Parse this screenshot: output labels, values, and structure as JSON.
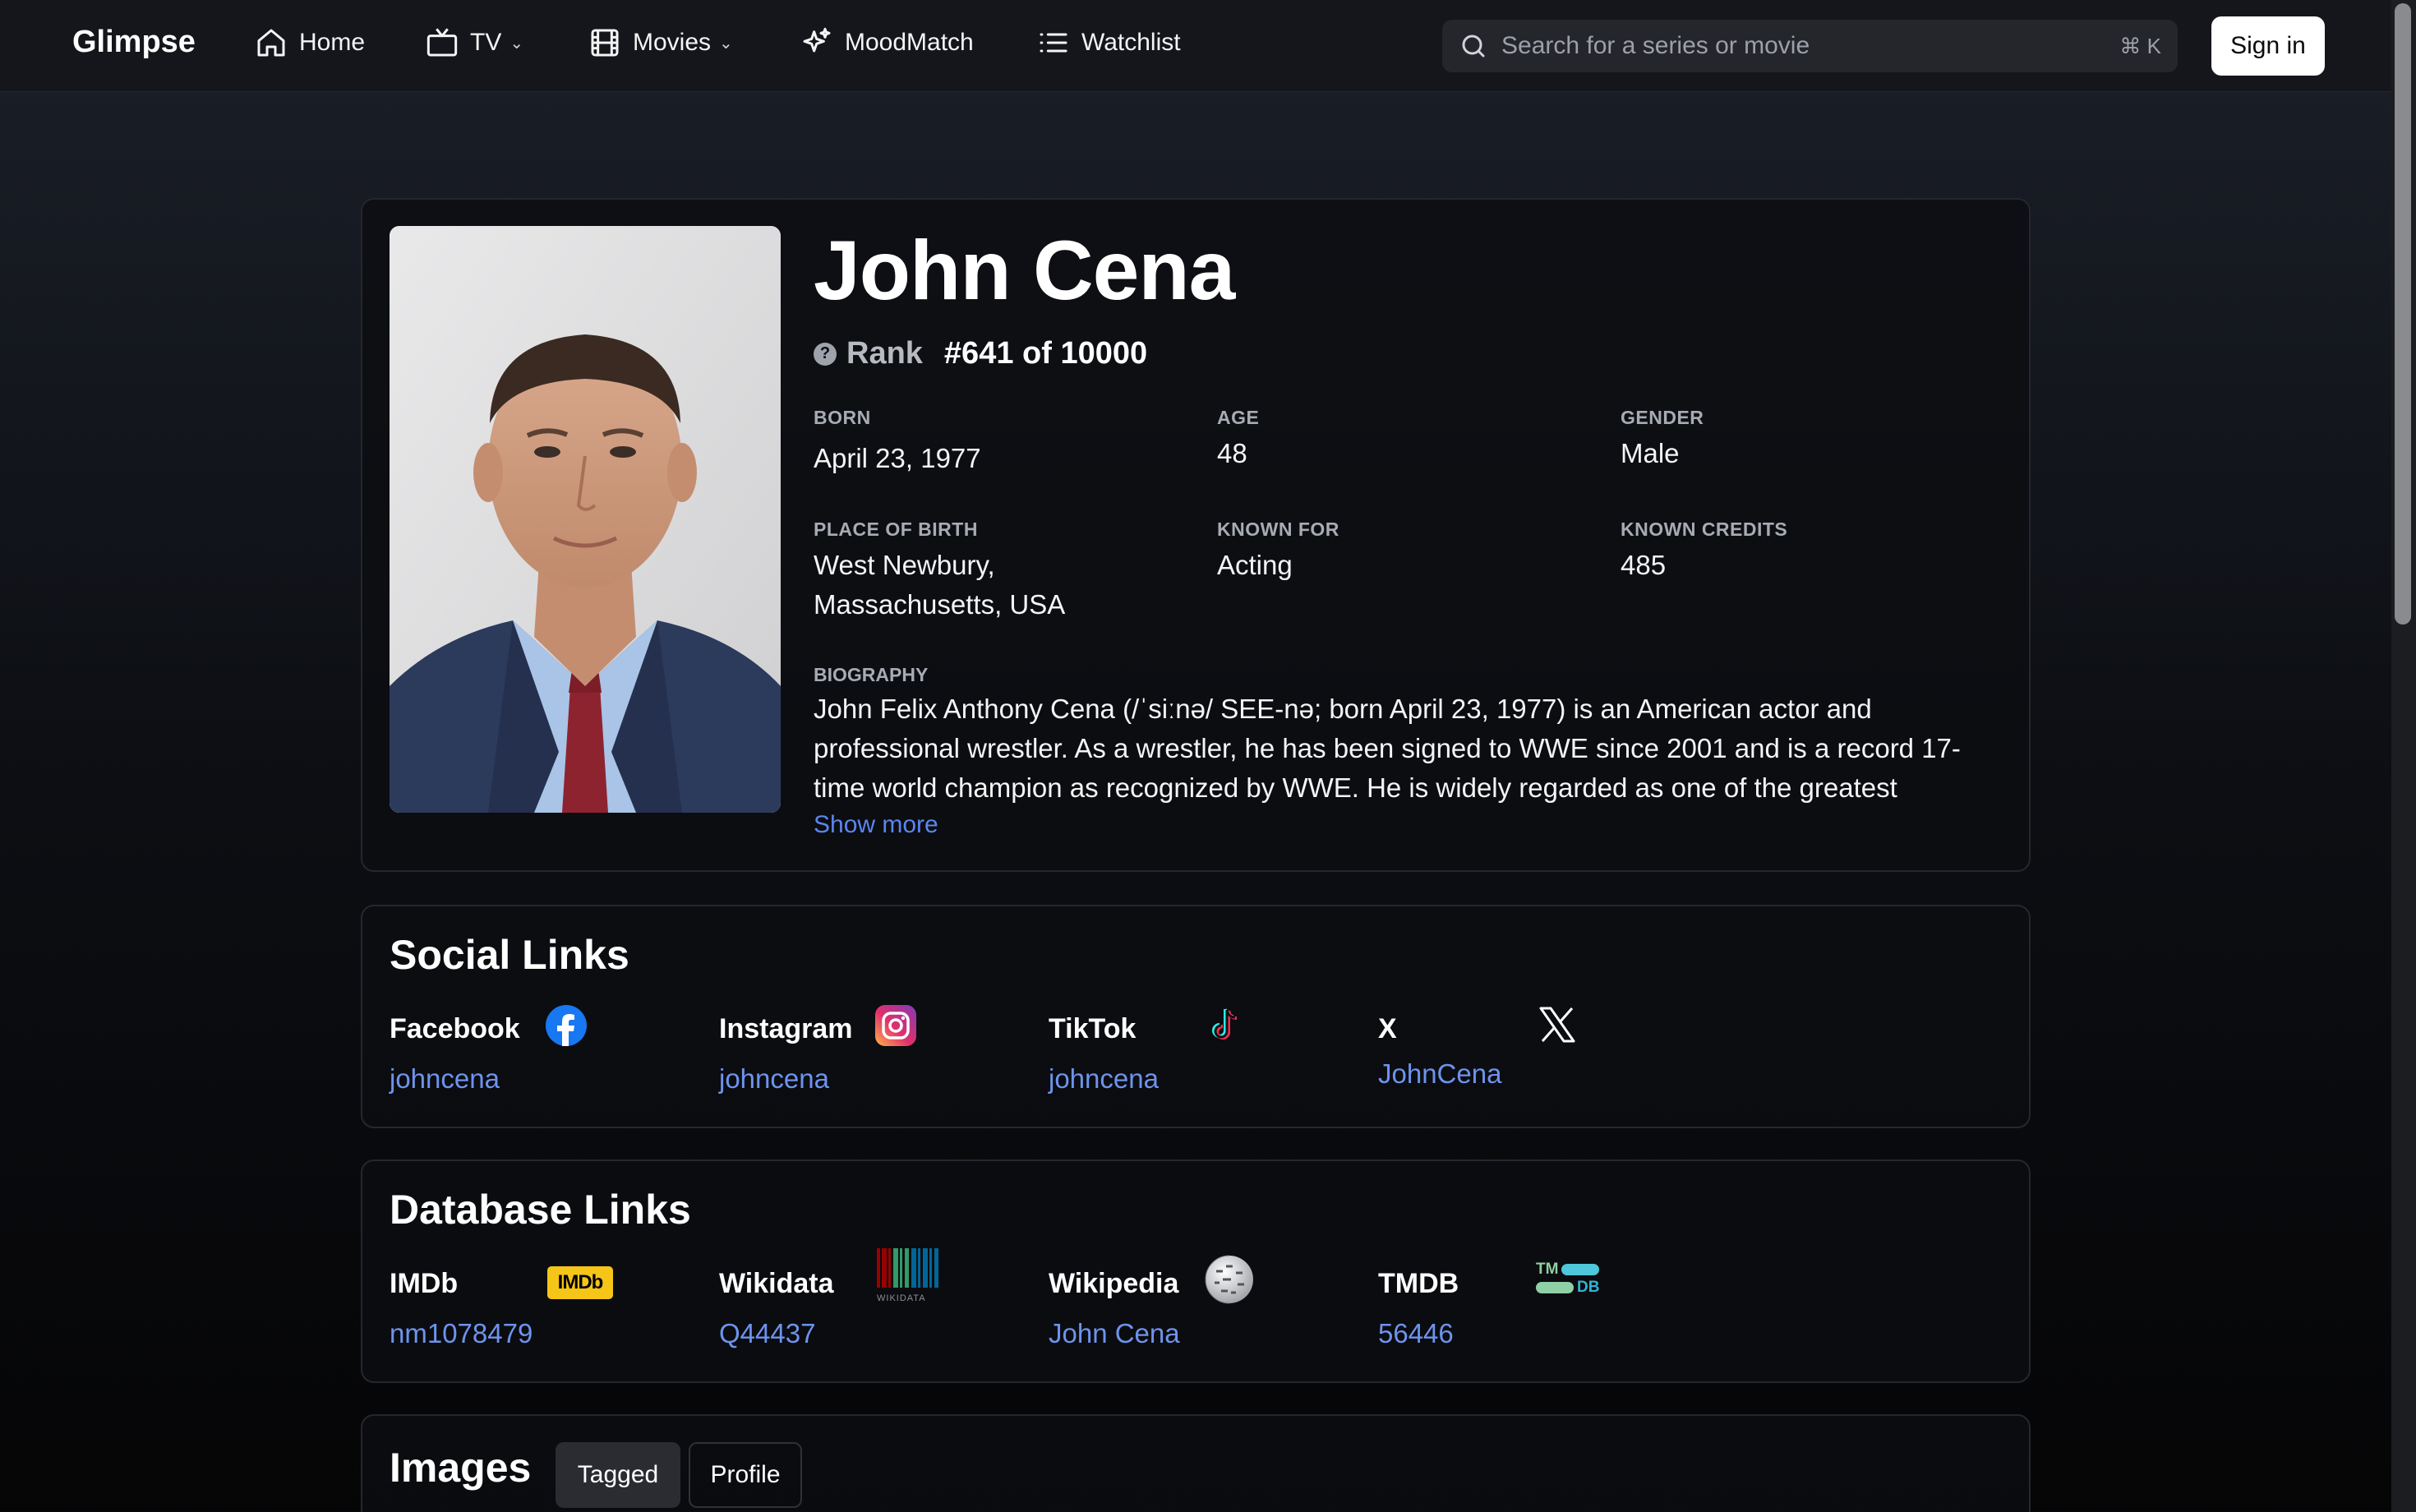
{
  "nav": {
    "brand": "Glimpse",
    "home": "Home",
    "tv": "TV",
    "movies": "Movies",
    "moodmatch": "MoodMatch",
    "watchlist": "Watchlist",
    "search_placeholder": "Search for a series or movie",
    "shortcut": "⌘ K",
    "signin": "Sign in"
  },
  "person": {
    "name": "John Cena",
    "rank_label": "Rank",
    "rank_value": "#641 of 10000",
    "born_label": "BORN",
    "born": "April 23, 1977",
    "age_label": "AGE",
    "age": "48",
    "gender_label": "GENDER",
    "gender": "Male",
    "pob_label": "PLACE OF BIRTH",
    "pob_line1": "West Newbury,",
    "pob_line2": "Massachusetts, USA",
    "known_for_label": "KNOWN FOR",
    "known_for": "Acting",
    "known_credits_label": "KNOWN CREDITS",
    "known_credits": "485",
    "bio_label": "BIOGRAPHY",
    "bio": "John Felix Anthony Cena (/ˈsiːnə/ SEE-nə; born April 23, 1977) is an American actor and professional wrestler. As a wrestler, he has been signed to WWE since 2001 and is a record 17-time world champion as recognized by WWE. He is widely regarded as one of the greatest",
    "show_more": "Show more"
  },
  "social": {
    "title": "Social Links",
    "items": [
      {
        "name": "Facebook",
        "value": "johncena",
        "icon": "facebook-icon"
      },
      {
        "name": "Instagram",
        "value": "johncena",
        "icon": "instagram-icon"
      },
      {
        "name": "TikTok",
        "value": "johncena",
        "icon": "tiktok-icon"
      },
      {
        "name": "X",
        "value": "JohnCena",
        "icon": "x-icon"
      }
    ]
  },
  "database": {
    "title": "Database Links",
    "items": [
      {
        "name": "IMDb",
        "value": "nm1078479",
        "icon": "imdb-icon",
        "icon_text": "IMDb"
      },
      {
        "name": "Wikidata",
        "value": "Q44437",
        "icon": "wikidata-icon",
        "icon_text": "WIKIDATA"
      },
      {
        "name": "Wikipedia",
        "value": "John Cena",
        "icon": "wikipedia-icon"
      },
      {
        "name": "TMDB",
        "value": "56446",
        "icon": "tmdb-icon",
        "icon_text_top": "TM",
        "icon_text_bottom": "DB"
      }
    ]
  },
  "images": {
    "title": "Images",
    "tabs": [
      "Tagged",
      "Profile"
    ]
  },
  "colors": {
    "accent_link": "#6e93ee",
    "imdb_yellow": "#f5c518",
    "tmdb_teal": "#01b4e4"
  }
}
